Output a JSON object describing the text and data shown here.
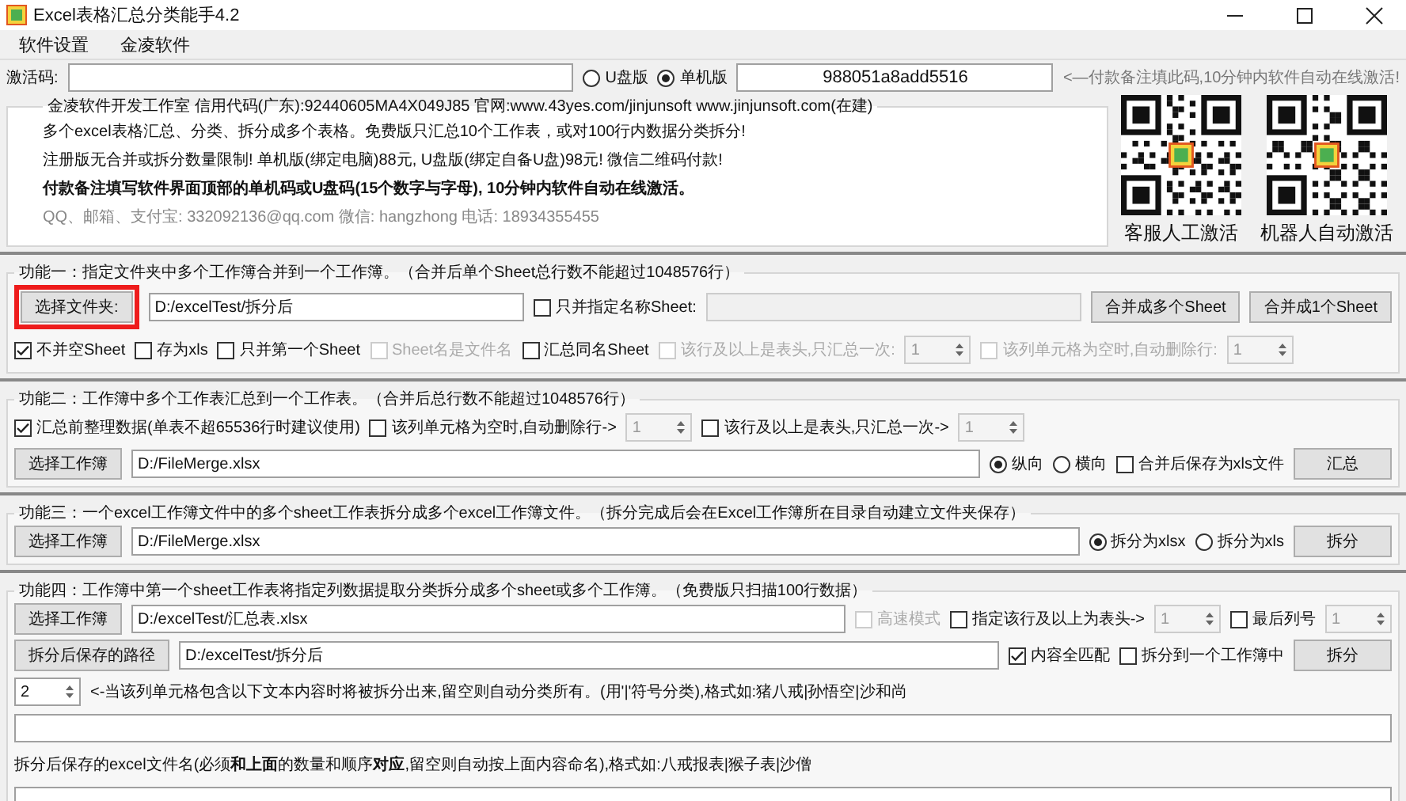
{
  "window": {
    "title": "Excel表格汇总分类能手4.2"
  },
  "menu": [
    {
      "label": "软件设置"
    },
    {
      "label": "金凌软件"
    }
  ],
  "activation": {
    "label": "激活码:",
    "editions": [
      {
        "label": "U盘版",
        "selected": false
      },
      {
        "label": "单机版",
        "selected": true
      }
    ],
    "machine_code": "988051a8add5516",
    "note": "<—付款备注填此码,10分钟内软件自动在线激活!"
  },
  "info": {
    "title": "金凌软件开发工作室 信用代码(广东):92440605MA4X049J85 官网:www.43yes.com/jinjunsoft  www.jinjunsoft.com(在建)",
    "lines": [
      {
        "kind": "normal",
        "text": "多个excel表格汇总、分类、拆分成多个表格。免费版只汇总10个工作表，或对100行内数据分类拆分!"
      },
      {
        "kind": "normal",
        "text": "注册版无合并或拆分数量限制! 单机版(绑定电脑)88元, U盘版(绑定自备U盘)98元! 微信二维码付款!"
      },
      {
        "kind": "bold",
        "text": "付款备注填写软件界面顶部的单机码或U盘码(15个数字与字母), 10分钟内软件自动在线激活。"
      },
      {
        "kind": "muted",
        "text": "QQ、邮箱、支付宝: 332092136@qq.com   微信: hangzhong   电话: 18934355455"
      }
    ]
  },
  "qr_codes": [
    {
      "caption": "客服人工激活"
    },
    {
      "caption": "机器人自动激活"
    }
  ],
  "features": [
    {
      "title": "功能一：指定文件夹中多个工作簿合并到一个工作簿。（合并后单个Sheet总行数不能超过1048576行）",
      "rows": [
        {
          "controls": [
            {
              "kind": "button",
              "label": "选择文件夹:",
              "highlighted": true
            },
            {
              "kind": "field",
              "value": "D:/excelTest/拆分后"
            },
            {
              "kind": "checkbox",
              "label": "只并指定名称Sheet:",
              "checked": false,
              "disabled": false
            },
            {
              "kind": "field",
              "disabled": true
            },
            {
              "kind": "button",
              "label": "合并成多个Sheet",
              "highlighted": false
            },
            {
              "kind": "button",
              "label": "合并成1个Sheet",
              "highlighted": false
            }
          ]
        },
        {
          "controls": [
            {
              "kind": "checkbox",
              "label": "不并空Sheet",
              "checked": true,
              "disabled": false
            },
            {
              "kind": "checkbox",
              "label": "存为xls",
              "checked": false,
              "disabled": false
            },
            {
              "kind": "checkbox",
              "label": "只并第一个Sheet",
              "checked": false,
              "disabled": false
            },
            {
              "kind": "checkbox",
              "label": "Sheet名是文件名",
              "checked": false,
              "disabled": true
            },
            {
              "kind": "checkbox",
              "label": "汇总同名Sheet",
              "checked": false,
              "disabled": false
            },
            {
              "kind": "checkbox",
              "label": "该行及以上是表头,只汇总一次:",
              "checked": false,
              "disabled": true
            },
            {
              "kind": "spin",
              "value": "1",
              "disabled": true
            },
            {
              "kind": "checkbox",
              "label": "该列单元格为空时,自动删除行:",
              "checked": false,
              "disabled": true
            },
            {
              "kind": "spin",
              "value": "1",
              "disabled": true
            }
          ]
        }
      ]
    },
    {
      "title": "功能二：工作簿中多个工作表汇总到一个工作表。（合并后总行数不能超过1048576行）",
      "rows": [
        {
          "controls": [
            {
              "kind": "checkbox",
              "label": "汇总前整理数据(单表不超65536行时建议使用)",
              "checked": true,
              "disabled": false
            },
            {
              "kind": "checkbox",
              "label": "该列单元格为空时,自动删除行->",
              "checked": false,
              "disabled": false
            },
            {
              "kind": "spin",
              "value": "1",
              "disabled": true
            },
            {
              "kind": "checkbox",
              "label": "该行及以上是表头,只汇总一次->",
              "checked": false,
              "disabled": false
            },
            {
              "kind": "spin",
              "value": "1",
              "disabled": true
            }
          ]
        },
        {
          "controls": [
            {
              "kind": "button",
              "label": "选择工作簿",
              "highlighted": false
            },
            {
              "kind": "field",
              "value": "D:/FileMerge.xlsx"
            },
            {
              "kind": "radio",
              "label": "纵向",
              "selected": true
            },
            {
              "kind": "radio",
              "label": "横向",
              "selected": false
            },
            {
              "kind": "checkbox",
              "label": "合并后保存为xls文件",
              "checked": false,
              "disabled": false
            },
            {
              "kind": "button",
              "label": "汇总",
              "highlighted": false
            }
          ]
        }
      ]
    },
    {
      "title": "功能三：一个excel工作簿文件中的多个sheet工作表拆分成多个excel工作簿文件。（拆分完成后会在Excel工作簿所在目录自动建立文件夹保存）",
      "rows": [
        {
          "controls": [
            {
              "kind": "button",
              "label": "选择工作簿",
              "highlighted": false
            },
            {
              "kind": "field",
              "value": "D:/FileMerge.xlsx"
            },
            {
              "kind": "radio",
              "label": "拆分为xlsx",
              "selected": true
            },
            {
              "kind": "radio",
              "label": "拆分为xls",
              "selected": false
            },
            {
              "kind": "button",
              "label": "拆分",
              "highlighted": false
            }
          ]
        }
      ]
    },
    {
      "title": "功能四：工作簿中第一个sheet工作表将指定列数据提取分类拆分成多个sheet或多个工作簿。（免费版只扫描100行数据）",
      "rows": [
        {
          "controls": [
            {
              "kind": "button",
              "label": "选择工作簿",
              "highlighted": false
            },
            {
              "kind": "field",
              "value": "D:/excelTest/汇总表.xlsx"
            },
            {
              "kind": "checkbox",
              "label": "高速模式",
              "checked": false,
              "disabled": true
            },
            {
              "kind": "checkbox",
              "label": "指定该行及以上为表头->",
              "checked": false,
              "disabled": false
            },
            {
              "kind": "spin",
              "value": "1",
              "disabled": true
            },
            {
              "kind": "checkbox",
              "label": "最后列号",
              "checked": false,
              "disabled": false
            },
            {
              "kind": "spin",
              "value": "1",
              "disabled": true
            }
          ]
        },
        {
          "controls": [
            {
              "kind": "button",
              "label": "拆分后保存的路径",
              "highlighted": false
            },
            {
              "kind": "field",
              "value": "D:/excelTest/拆分后"
            },
            {
              "kind": "checkbox",
              "label": "内容全匹配",
              "checked": true,
              "disabled": false
            },
            {
              "kind": "checkbox",
              "label": "拆分到一个工作簿中",
              "checked": false,
              "disabled": false
            },
            {
              "kind": "button",
              "label": "拆分",
              "highlighted": false
            }
          ]
        },
        {
          "controls": [
            {
              "kind": "spin",
              "value": "2",
              "disabled": false
            },
            {
              "kind": "text",
              "text": "<-当该列单元格包含以下文本内容时将被拆分出来,留空则自动分类所有。(用'|'符号分类),格式如:猪八戒|孙悟空|沙和尚"
            }
          ]
        },
        {
          "controls": [
            {
              "kind": "field",
              "disabled": false
            }
          ]
        },
        {
          "controls": [
            {
              "kind": "text",
              "text": "拆分后保存的excel文件名(必须**和上面**的数量和顺序**对应**,留空则自动按上面内容命名),格式如:八戒报表|猴子表|沙僧"
            }
          ]
        },
        {
          "controls": [
            {
              "kind": "field",
              "disabled": false
            }
          ]
        }
      ]
    }
  ]
}
